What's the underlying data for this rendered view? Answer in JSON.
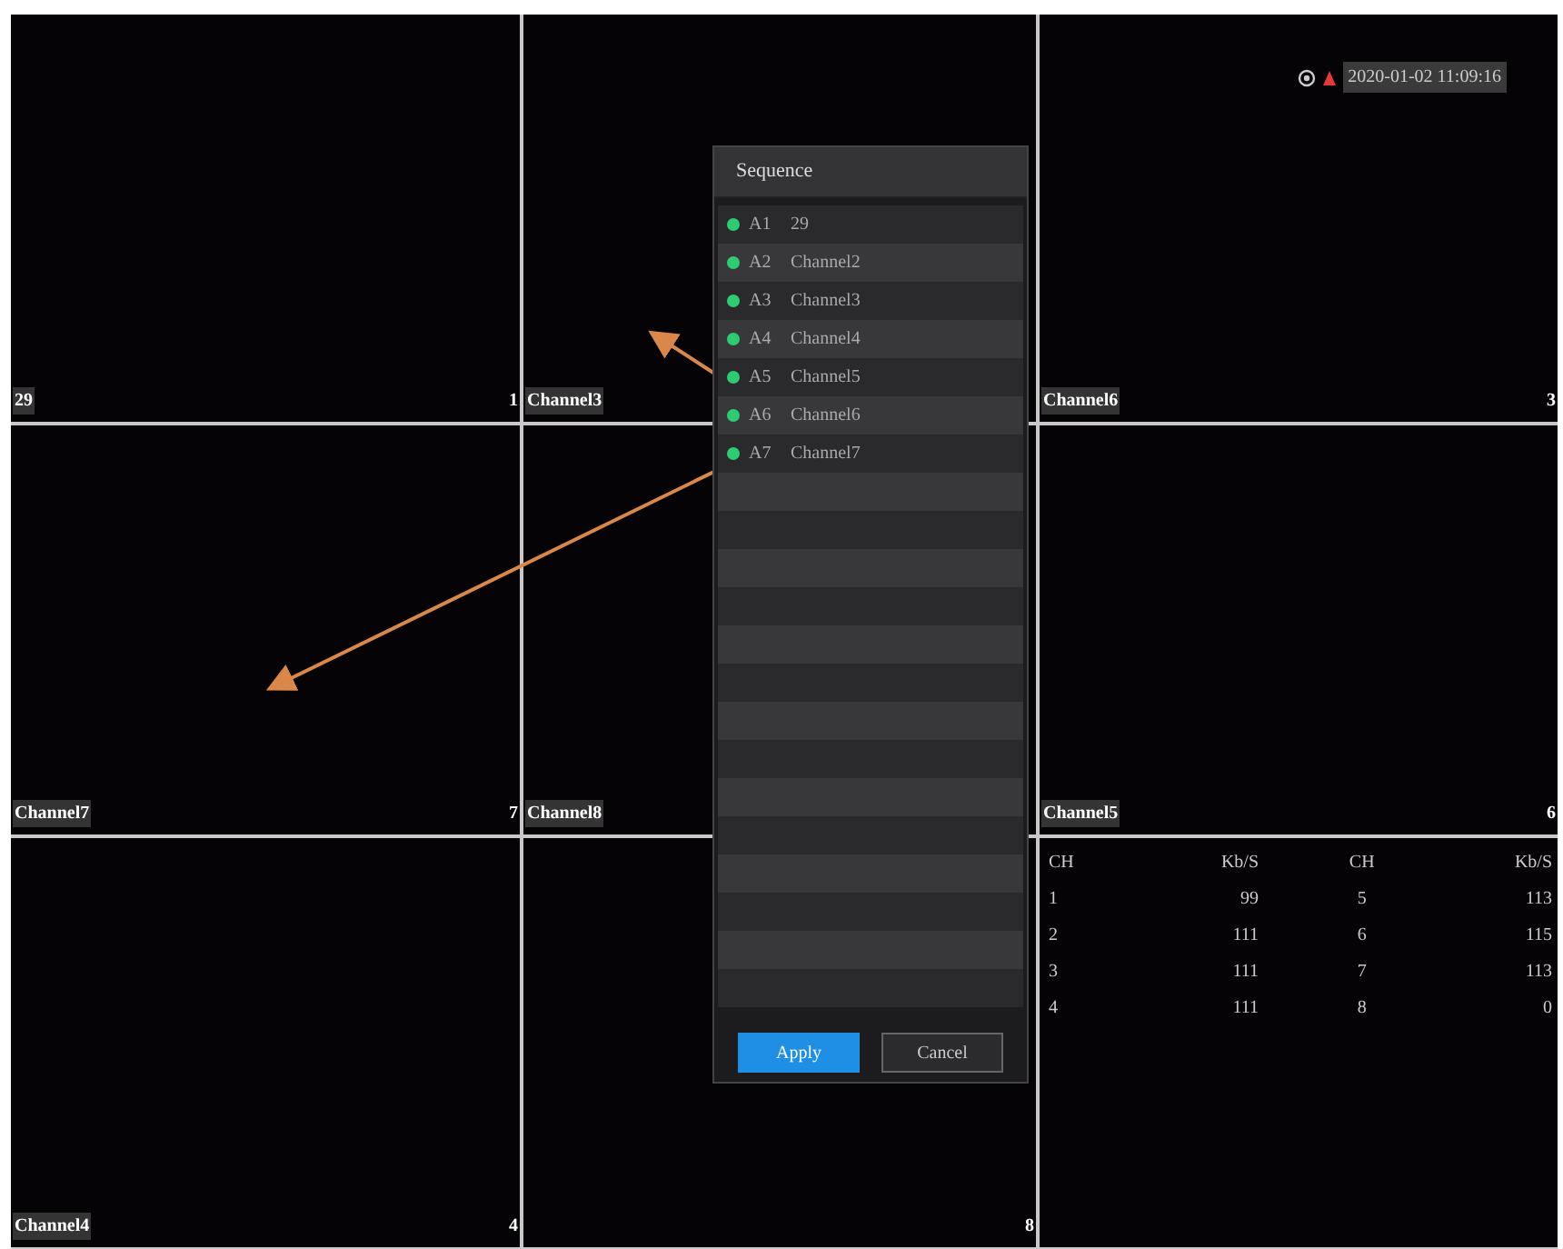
{
  "tiles": [
    {
      "kind": "video",
      "name": "29",
      "number": "1"
    },
    {
      "kind": "video",
      "name": "Channel3"
    },
    {
      "kind": "video",
      "name": "Channel6",
      "number": "3",
      "datetime": "2020-01-02 11:09:16"
    },
    {
      "kind": "video",
      "name": "Channel7",
      "number": "7"
    },
    {
      "kind": "video",
      "name": "Channel8"
    },
    {
      "kind": "video",
      "name": "Channel5",
      "number": "6"
    },
    {
      "kind": "video",
      "name": "Channel4",
      "number": "4"
    },
    {
      "kind": "video",
      "number": "8"
    },
    {
      "kind": "stats",
      "columns": [
        "CH",
        "Kb/S",
        "CH",
        "Kb/S"
      ],
      "rows": [
        [
          "1",
          "99",
          "5",
          "113"
        ],
        [
          "2",
          "111",
          "6",
          "115"
        ],
        [
          "3",
          "111",
          "7",
          "113"
        ],
        [
          "4",
          "111",
          "8",
          "0"
        ]
      ]
    }
  ],
  "dialog": {
    "title": "Sequence",
    "items": [
      {
        "code": "A1",
        "name": "29",
        "color": "#2ecc71"
      },
      {
        "code": "A2",
        "name": "Channel2",
        "color": "#2ecc71"
      },
      {
        "code": "A3",
        "name": "Channel3",
        "color": "#2ecc71"
      },
      {
        "code": "A4",
        "name": "Channel4",
        "color": "#2ecc71"
      },
      {
        "code": "A5",
        "name": "Channel5",
        "color": "#2ecc71"
      },
      {
        "code": "A6",
        "name": "Channel6",
        "color": "#2ecc71"
      },
      {
        "code": "A7",
        "name": "Channel7",
        "color": "#2ecc71"
      }
    ],
    "buttons": [
      {
        "label": "Apply",
        "kind": "primary"
      },
      {
        "label": "Cancel",
        "kind": "secondary"
      }
    ]
  }
}
